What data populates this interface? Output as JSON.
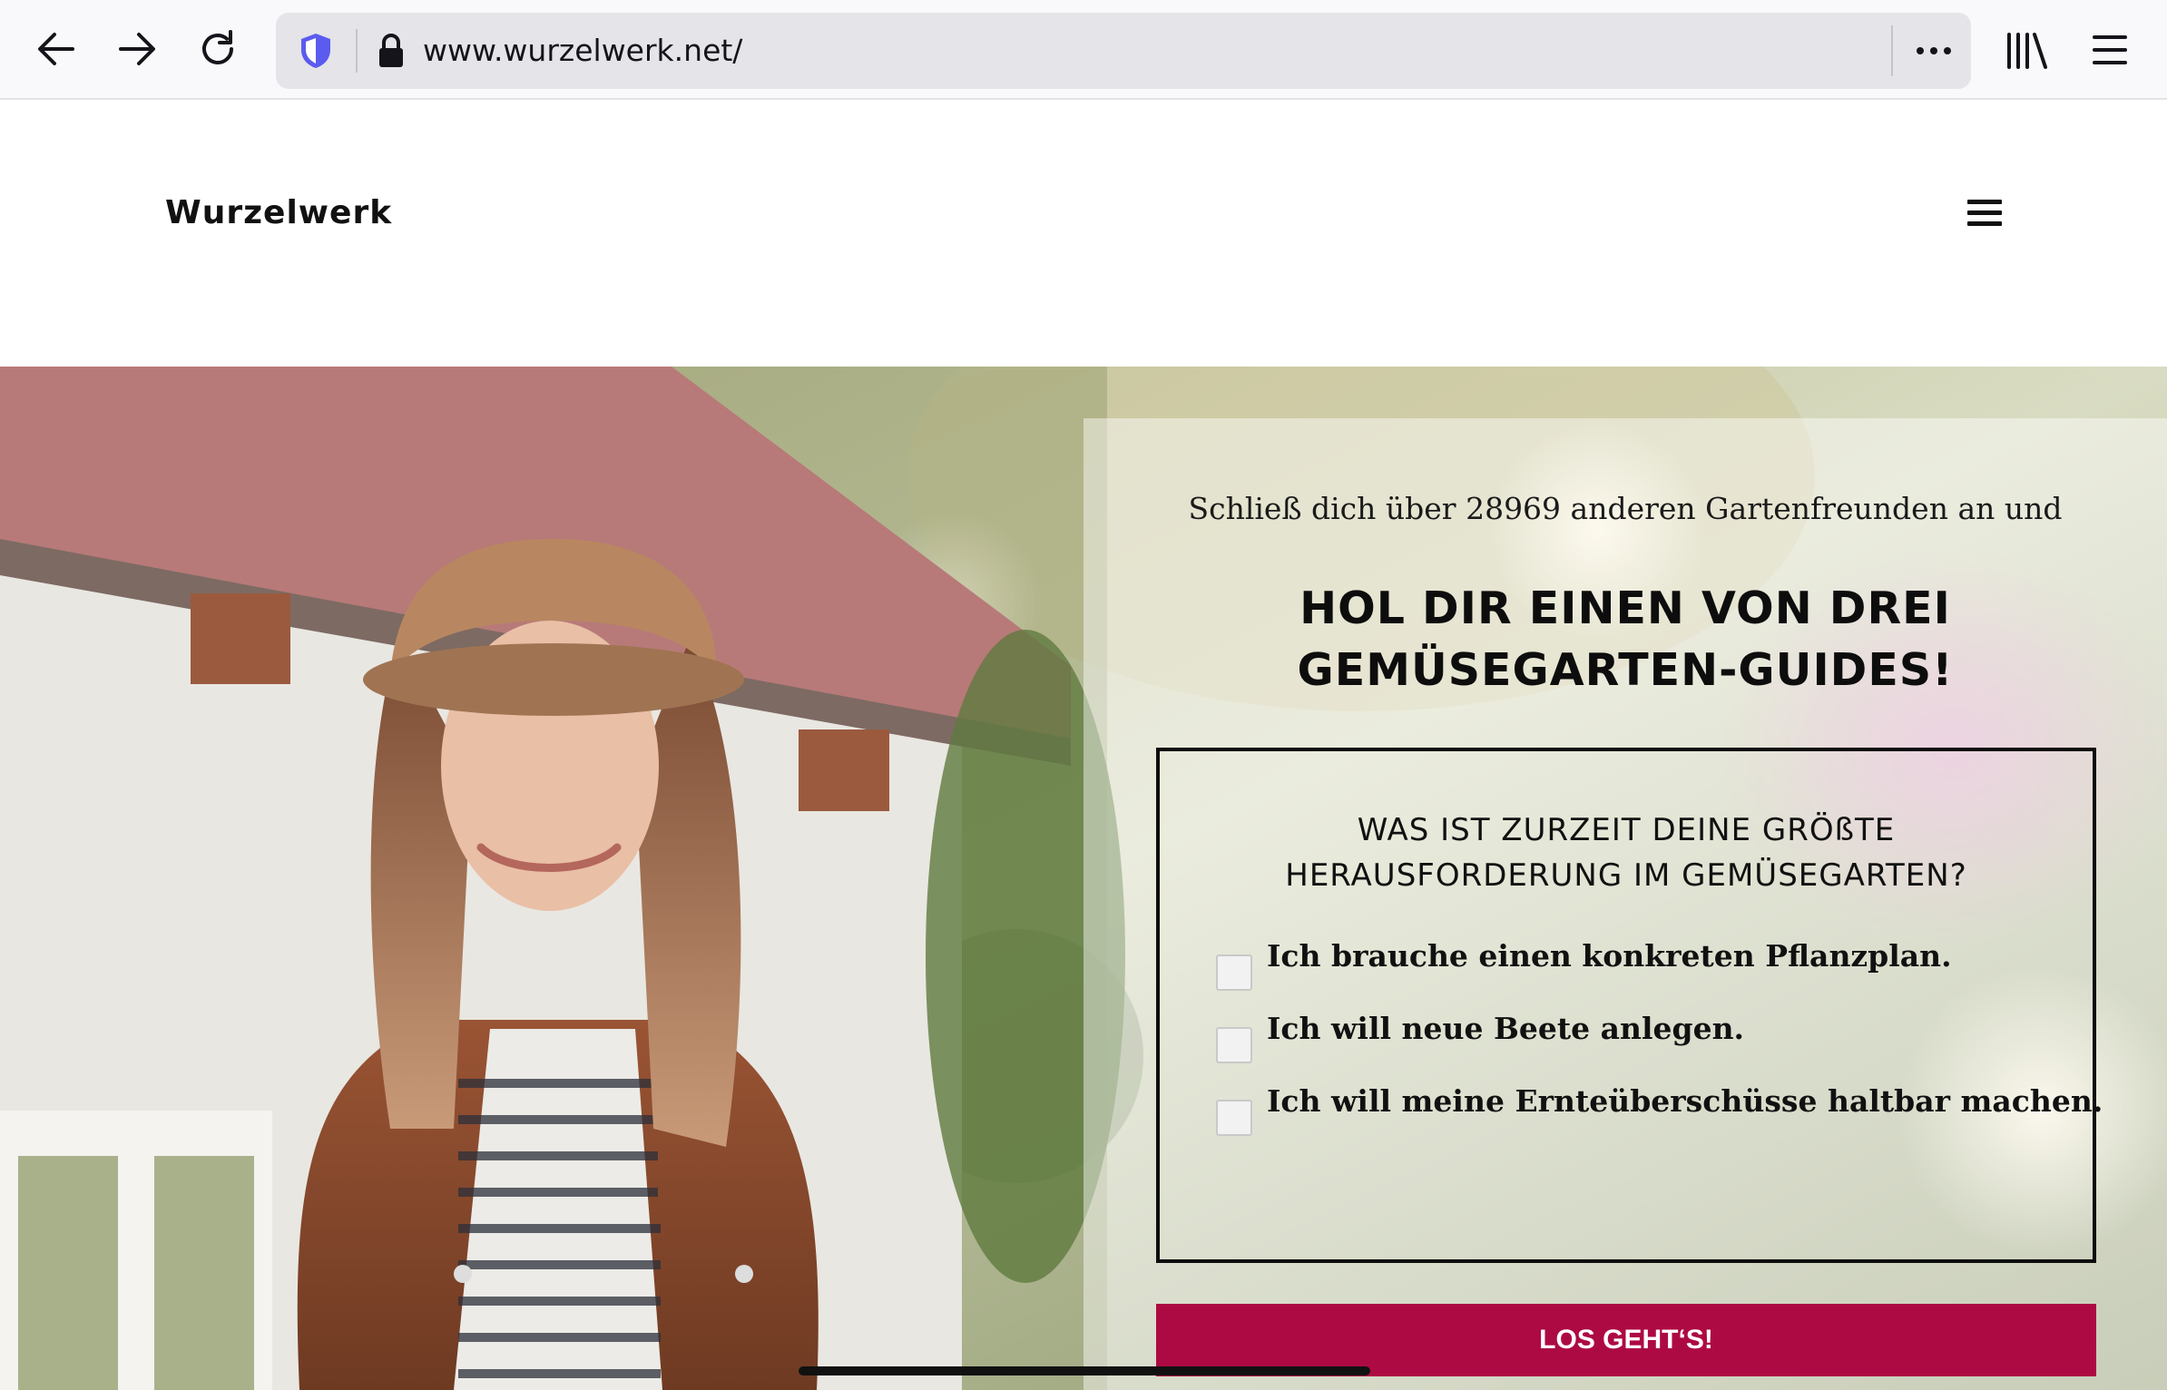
{
  "browser": {
    "url": "www.wurzelwerk.net/"
  },
  "site": {
    "logo": "Wurzelwerk"
  },
  "optin": {
    "intro": "Schließ dich über 28969 anderen Gartenfreunden an und",
    "headline_line1": "HOL DIR EINEN VON DREI",
    "headline_line2": "GEMÜSEGARTEN-GUIDES!",
    "question_line1": "WAS IST ZURZEIT DEINE GRÖßTE",
    "question_line2": "HERAUSFORDERUNG IM GEMÜSEGARTEN?",
    "options": [
      {
        "label": "Ich brauche einen konkreten Pflanzplan.",
        "checked": false
      },
      {
        "label": "Ich will neue Beete anlegen.",
        "checked": false
      },
      {
        "label": "Ich will meine Ernteüberschüsse haltbar machen.",
        "checked": false
      }
    ],
    "cta_label": "LOS GEHT‘S!"
  },
  "colors": {
    "cta_background": "#ad0a43",
    "url_bar": "#e4e4e9",
    "shield_accent": "#5b5bef"
  }
}
